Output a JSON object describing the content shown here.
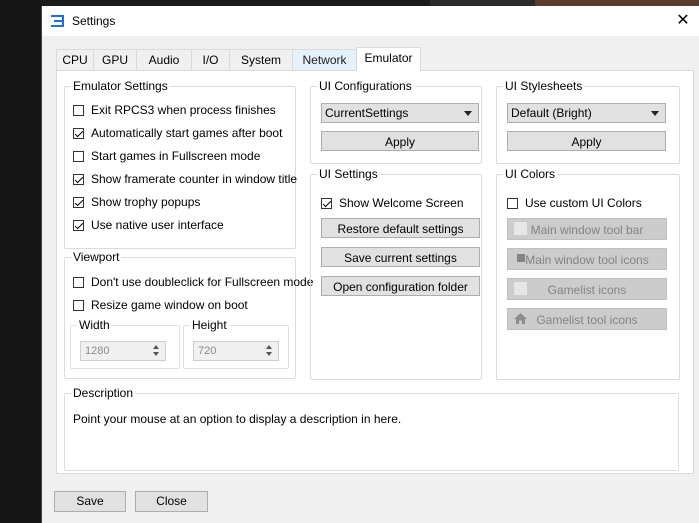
{
  "window": {
    "title": "Settings",
    "app_icon": "rpcs3-icon",
    "close_glyph": "✕"
  },
  "tabs": [
    "CPU",
    "GPU",
    "Audio",
    "I/O",
    "System",
    "Network",
    "Emulator"
  ],
  "active_tab": "Emulator",
  "emulator_settings": {
    "title": "Emulator Settings",
    "items": [
      {
        "label": "Exit RPCS3 when process finishes",
        "checked": false
      },
      {
        "label": "Automatically start games after boot",
        "checked": true
      },
      {
        "label": "Start games in Fullscreen mode",
        "checked": false
      },
      {
        "label": "Show framerate counter in window title",
        "checked": true
      },
      {
        "label": "Show trophy popups",
        "checked": true
      },
      {
        "label": "Use native user interface",
        "checked": true
      }
    ]
  },
  "viewport": {
    "title": "Viewport",
    "items": [
      {
        "label": "Don't use doubleclick for Fullscreen mode",
        "checked": false
      },
      {
        "label": "Resize game window on boot",
        "checked": false
      }
    ],
    "width": {
      "label": "Width",
      "value": "1280"
    },
    "height": {
      "label": "Height",
      "value": "720"
    }
  },
  "ui_configurations": {
    "title": "UI Configurations",
    "selected": "CurrentSettings",
    "apply_label": "Apply"
  },
  "ui_stylesheets": {
    "title": "UI Stylesheets",
    "selected": "Default (Bright)",
    "apply_label": "Apply"
  },
  "ui_settings": {
    "title": "UI Settings",
    "show_welcome": {
      "label": "Show Welcome Screen",
      "checked": true
    },
    "restore_label": "Restore default settings",
    "save_label": "Save current settings",
    "open_folder_label": "Open configuration folder"
  },
  "ui_colors": {
    "title": "UI Colors",
    "custom": {
      "label": "Use custom UI Colors",
      "checked": false
    },
    "buttons": [
      "Main window tool bar",
      "Main window tool icons",
      "Gamelist icons",
      "Gamelist tool icons"
    ]
  },
  "description": {
    "title": "Description",
    "text": "Point your mouse at an option to display a description in here."
  },
  "footer": {
    "save_label": "Save",
    "close_label": "Close"
  }
}
